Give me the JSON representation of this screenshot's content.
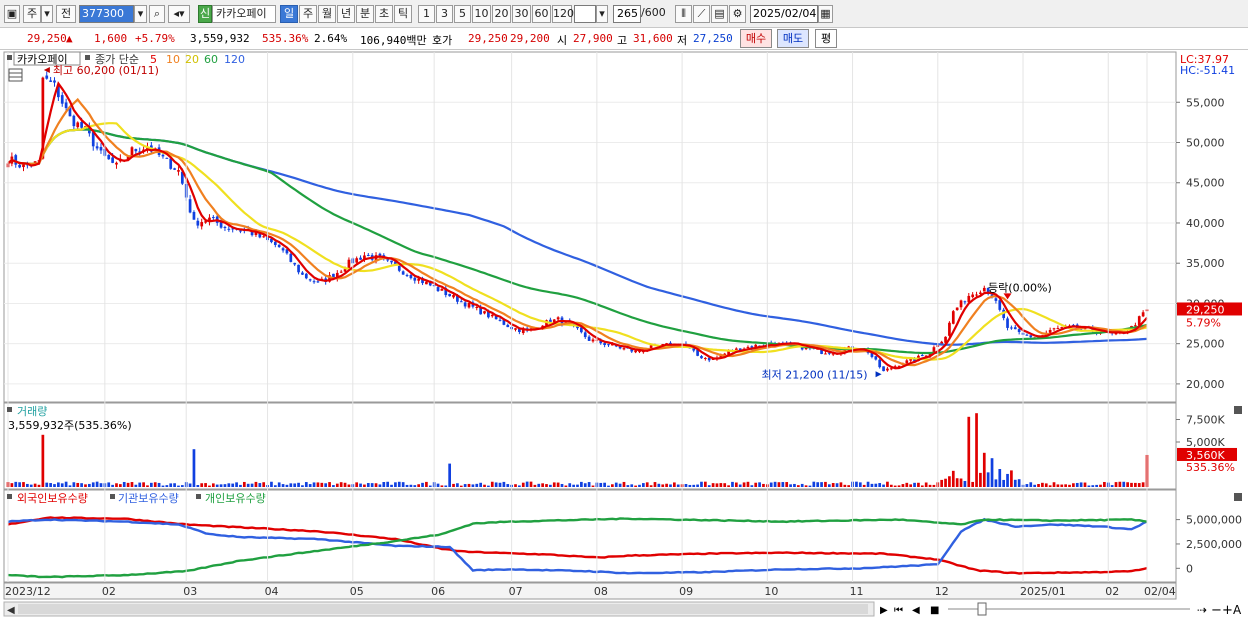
{
  "toolbar": {
    "market": "주",
    "prev_label": "전",
    "code": "377300",
    "new_badge": "신",
    "stock_name": "카카오페이",
    "periods": [
      "일",
      "주",
      "월",
      "년",
      "분",
      "초",
      "틱"
    ],
    "active_period": "일",
    "intervals": [
      "1",
      "3",
      "5",
      "10",
      "20",
      "30",
      "60",
      "120"
    ],
    "count": "265",
    "count_total": "/600",
    "date": "2025/02/04"
  },
  "quote": {
    "price": "29,250",
    "arrow": "▲",
    "change": "1,600",
    "change_pct": "+5.79%",
    "volume": "3,559,932",
    "volume_ratio": "535.36%",
    "turnover": "2.64%",
    "amount": "106,940백만",
    "bid_label": "호가",
    "ask": "29,250",
    "bid": "29,200",
    "open_label": "시",
    "open": "27,900",
    "high_label": "고",
    "high": "31,600",
    "low_label": "저",
    "low": "27,250",
    "buy_label": "매수",
    "sell_label": "매도",
    "eval_label": "평"
  },
  "colors": {
    "up": "#e00000",
    "down": "#1040e0",
    "ma5": "#e00000",
    "ma10": "#f08020",
    "ma20": "#f0e020",
    "ma60": "#20a040",
    "ma120": "#3060e0",
    "foreign": "#e00000",
    "institution": "#3060e0",
    "individual": "#20a040"
  },
  "chart_data": [
    {
      "type": "candlestick",
      "legend_name": "카카오페이",
      "legend_price": "종가 단순",
      "ma_periods": [
        "5",
        "10",
        "20",
        "60",
        "120"
      ],
      "lc_label": "LC:37.97",
      "hc_label": "HC:-51.41",
      "max_annotation": "최고 60,200 (01/11)",
      "min_annotation": "최저 21,200 (11/15)",
      "mid_annotation": "등락(0.00%)",
      "current_label": "29,250",
      "current_pct": "5.79%",
      "y_ticks": [
        "55,000",
        "50,000",
        "45,000",
        "40,000",
        "35,000",
        "30,000",
        "25,000",
        "20,000"
      ],
      "y_tick_values": [
        55000,
        50000,
        45000,
        40000,
        35000,
        30000,
        25000,
        20000
      ],
      "ylim": [
        18000,
        61000
      ],
      "x_ticks": [
        "2023/12",
        "02",
        "03",
        "04",
        "05",
        "06",
        "07",
        "08",
        "09",
        "10",
        "11",
        "12",
        "2025/01",
        "02",
        "02/04"
      ],
      "x_tick_index": [
        0,
        25,
        46,
        67,
        89,
        110,
        130,
        152,
        174,
        196,
        218,
        240,
        262,
        284,
        294
      ],
      "n_days": 295,
      "anchors": [
        [
          0,
          48000
        ],
        [
          4,
          47000
        ],
        [
          8,
          47500
        ],
        [
          9,
          58000
        ],
        [
          12,
          57000
        ],
        [
          16,
          53000
        ],
        [
          20,
          51500
        ],
        [
          24,
          48500
        ],
        [
          28,
          47000
        ],
        [
          32,
          49000
        ],
        [
          36,
          49500
        ],
        [
          40,
          48000
        ],
        [
          44,
          46500
        ],
        [
          48,
          40000
        ],
        [
          52,
          40500
        ],
        [
          56,
          39500
        ],
        [
          62,
          39000
        ],
        [
          66,
          38000
        ],
        [
          70,
          37000
        ],
        [
          76,
          33500
        ],
        [
          80,
          32500
        ],
        [
          84,
          33500
        ],
        [
          88,
          35000
        ],
        [
          92,
          36000
        ],
        [
          96,
          35500
        ],
        [
          100,
          34500
        ],
        [
          106,
          33000
        ],
        [
          112,
          31500
        ],
        [
          118,
          30000
        ],
        [
          124,
          28500
        ],
        [
          130,
          27000
        ],
        [
          134,
          26500
        ],
        [
          138,
          27500
        ],
        [
          142,
          28000
        ],
        [
          146,
          27000
        ],
        [
          150,
          25500
        ],
        [
          154,
          25000
        ],
        [
          158,
          24500
        ],
        [
          162,
          24000
        ],
        [
          166,
          24500
        ],
        [
          170,
          24800
        ],
        [
          174,
          25000
        ],
        [
          178,
          23500
        ],
        [
          182,
          23000
        ],
        [
          186,
          24000
        ],
        [
          190,
          24500
        ],
        [
          194,
          24800
        ],
        [
          198,
          25000
        ],
        [
          202,
          24800
        ],
        [
          206,
          24500
        ],
        [
          210,
          24000
        ],
        [
          214,
          24000
        ],
        [
          218,
          24500
        ],
        [
          222,
          24000
        ],
        [
          226,
          21500
        ],
        [
          230,
          22500
        ],
        [
          234,
          23000
        ],
        [
          238,
          24000
        ],
        [
          242,
          26000
        ],
        [
          244,
          29000
        ],
        [
          248,
          31000
        ],
        [
          252,
          32000
        ],
        [
          254,
          31000
        ],
        [
          258,
          27000
        ],
        [
          262,
          26000
        ],
        [
          266,
          25800
        ],
        [
          270,
          26800
        ],
        [
          274,
          27000
        ],
        [
          278,
          26800
        ],
        [
          282,
          26500
        ],
        [
          286,
          26000
        ],
        [
          290,
          27000
        ],
        [
          294,
          29250
        ]
      ]
    },
    {
      "type": "bar",
      "title": "거래량",
      "summary": "3,559,932주(535.36%)",
      "y_ticks": [
        "7,500K",
        "5,000K"
      ],
      "y_tick_values": [
        7500000,
        5000000
      ],
      "current_label": "3,560K",
      "current_pct": "535.36%",
      "ylim": [
        0,
        9000000
      ],
      "spikes": [
        [
          9,
          5800000
        ],
        [
          48,
          4200000
        ],
        [
          114,
          2600000
        ],
        [
          248,
          7800000
        ],
        [
          250,
          8200000
        ],
        [
          252,
          3800000
        ],
        [
          254,
          3200000
        ],
        [
          256,
          2000000
        ],
        [
          294,
          3560000
        ]
      ]
    },
    {
      "type": "line",
      "legend": [
        "외국인보유수량",
        "기관보유수량",
        "개인보유수량"
      ],
      "y_ticks": [
        "5,000,000",
        "2,500,000",
        "0"
      ],
      "y_tick_values": [
        5000000,
        2500000,
        0
      ],
      "ylim": [
        -1200000,
        6500000
      ],
      "series": [
        {
          "name": "외국인보유수량",
          "anchors": [
            [
              0,
              4500000
            ],
            [
              10,
              5200000
            ],
            [
              30,
              5100000
            ],
            [
              46,
              4500000
            ],
            [
              60,
              4200000
            ],
            [
              80,
              3800000
            ],
            [
              100,
              3000000
            ],
            [
              112,
              2000000
            ],
            [
              118,
              1700000
            ],
            [
              140,
              1400000
            ],
            [
              152,
              1100000
            ],
            [
              160,
              1300000
            ],
            [
              180,
              1500000
            ],
            [
              200,
              1600000
            ],
            [
              226,
              1500000
            ],
            [
              240,
              900000
            ],
            [
              250,
              -200000
            ],
            [
              260,
              -500000
            ],
            [
              280,
              -400000
            ],
            [
              290,
              -300000
            ],
            [
              294,
              0
            ]
          ]
        },
        {
          "name": "기관보유수량",
          "anchors": [
            [
              0,
              4800000
            ],
            [
              10,
              5000000
            ],
            [
              30,
              4800000
            ],
            [
              44,
              4500000
            ],
            [
              52,
              3500000
            ],
            [
              60,
              3200000
            ],
            [
              80,
              3000000
            ],
            [
              100,
              2300000
            ],
            [
              114,
              2200000
            ],
            [
              120,
              -200000
            ],
            [
              130,
              -100000
            ],
            [
              150,
              -300000
            ],
            [
              160,
              -500000
            ],
            [
              180,
              -400000
            ],
            [
              200,
              -100000
            ],
            [
              220,
              0
            ],
            [
              240,
              400000
            ],
            [
              246,
              3800000
            ],
            [
              252,
              5000000
            ],
            [
              260,
              4300000
            ],
            [
              270,
              4500000
            ],
            [
              282,
              4300000
            ],
            [
              290,
              4000000
            ],
            [
              294,
              4800000
            ]
          ]
        },
        {
          "name": "개인보유수량",
          "anchors": [
            [
              0,
              -700000
            ],
            [
              10,
              -900000
            ],
            [
              30,
              -700000
            ],
            [
              46,
              -300000
            ],
            [
              60,
              800000
            ],
            [
              80,
              1800000
            ],
            [
              100,
              2800000
            ],
            [
              112,
              3500000
            ],
            [
              120,
              4600000
            ],
            [
              130,
              4800000
            ],
            [
              160,
              5100000
            ],
            [
              200,
              4800000
            ],
            [
              230,
              5000000
            ],
            [
              246,
              4500000
            ],
            [
              252,
              5000000
            ],
            [
              270,
              4900000
            ],
            [
              290,
              5000000
            ],
            [
              294,
              4800000
            ]
          ]
        }
      ]
    }
  ]
}
